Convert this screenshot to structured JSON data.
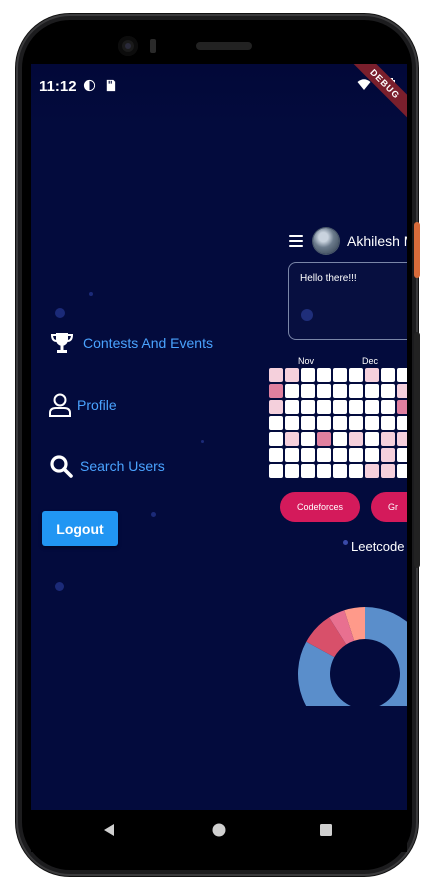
{
  "status_bar": {
    "time": "11:12",
    "debug_label": "DEBUG"
  },
  "drawer": {
    "items": [
      {
        "label": "Contests And Events",
        "icon": "trophy-icon"
      },
      {
        "label": "Profile",
        "icon": "person-icon"
      },
      {
        "label": "Search Users",
        "icon": "search-icon"
      }
    ],
    "logout_label": "Logout"
  },
  "main": {
    "user_name": "Akhilesh M",
    "hello_text": "Hello there!!!",
    "months": [
      "Nov",
      "Dec"
    ],
    "platform_buttons": [
      "Codeforces",
      "Gr"
    ],
    "leetcode_title": "Leetcode"
  },
  "colors": {
    "background": "#030b3d",
    "accent": "#2196f3",
    "menu_text": "#4aa3ff",
    "pill": "#d41a5b"
  },
  "heatmap": {
    "levels": [
      [
        1,
        1,
        0,
        0,
        0,
        0,
        1,
        0,
        0,
        0
      ],
      [
        2,
        0,
        0,
        0,
        0,
        0,
        0,
        0,
        1,
        0
      ],
      [
        1,
        0,
        0,
        0,
        0,
        0,
        0,
        0,
        2,
        0
      ],
      [
        0,
        0,
        0,
        0,
        0,
        0,
        0,
        0,
        0,
        0
      ],
      [
        0,
        1,
        0,
        2,
        0,
        1,
        0,
        1,
        1,
        0
      ],
      [
        0,
        0,
        0,
        0,
        0,
        0,
        0,
        1,
        0,
        0
      ],
      [
        0,
        0,
        0,
        0,
        0,
        0,
        1,
        1,
        0,
        0
      ]
    ]
  },
  "chart_data": {
    "type": "pie",
    "title": "Leetcode",
    "slices": [
      {
        "color": "#5a8ecb",
        "value": 83
      },
      {
        "color": "#d8506a",
        "value": 8
      },
      {
        "color": "#e87090",
        "value": 4
      },
      {
        "color": "#ff9a8a",
        "value": 5
      }
    ]
  }
}
